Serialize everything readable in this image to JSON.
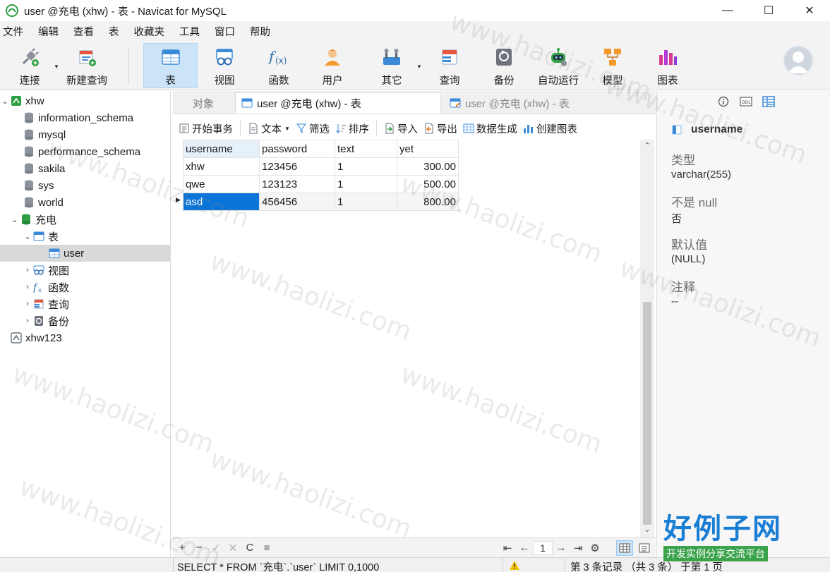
{
  "window": {
    "title": "user @充电 (xhw) - 表 - Navicat for MySQL",
    "controls": {
      "minimize": "—",
      "maximize": "☐",
      "close": "✕"
    }
  },
  "menu": [
    "文件",
    "编辑",
    "查看",
    "表",
    "收藏夹",
    "工具",
    "窗口",
    "帮助"
  ],
  "toolbar": {
    "items": [
      {
        "label": "连接",
        "icon": "connect-plug-icon",
        "has_dropdown": true
      },
      {
        "label": "新建查询",
        "icon": "new-query-icon"
      },
      {
        "label": "表",
        "icon": "table-icon",
        "active": true
      },
      {
        "label": "视图",
        "icon": "view-glasses-icon"
      },
      {
        "label": "函数",
        "icon": "function-fx-icon"
      },
      {
        "label": "用户",
        "icon": "user-person-icon"
      },
      {
        "label": "其它",
        "icon": "tools-icon",
        "has_dropdown": true
      },
      {
        "label": "查询",
        "icon": "query-icon"
      },
      {
        "label": "备份",
        "icon": "backup-icon"
      },
      {
        "label": "自动运行",
        "icon": "robot-icon"
      },
      {
        "label": "模型",
        "icon": "model-icon"
      },
      {
        "label": "图表",
        "icon": "chart-icon"
      }
    ]
  },
  "navigator": {
    "nodes": [
      {
        "label": "xhw",
        "level": 0,
        "expanded": true,
        "icon": "connection-icon"
      },
      {
        "label": "information_schema",
        "level": 1,
        "icon": "database-icon"
      },
      {
        "label": "mysql",
        "level": 1,
        "icon": "database-icon"
      },
      {
        "label": "performance_schema",
        "level": 1,
        "icon": "database-icon"
      },
      {
        "label": "sakila",
        "level": 1,
        "icon": "database-icon"
      },
      {
        "label": "sys",
        "level": 1,
        "icon": "database-icon"
      },
      {
        "label": "world",
        "level": 1,
        "icon": "database-icon"
      },
      {
        "label": "充电",
        "level": 1,
        "expanded": true,
        "icon": "database-open-icon"
      },
      {
        "label": "表",
        "level": 2,
        "expanded": true,
        "icon": "tables-folder-icon"
      },
      {
        "label": "user",
        "level": 3,
        "selected": true,
        "icon": "table-icon"
      },
      {
        "label": "视图",
        "level": 2,
        "collapsed": true,
        "icon": "views-folder-icon"
      },
      {
        "label": "函数",
        "level": 2,
        "collapsed": true,
        "icon": "functions-folder-icon"
      },
      {
        "label": "查询",
        "level": 2,
        "collapsed": true,
        "icon": "queries-folder-icon"
      },
      {
        "label": "备份",
        "level": 2,
        "collapsed": true,
        "icon": "backups-folder-icon"
      },
      {
        "label": "xhw123",
        "level": 0,
        "icon": "connection-closed-icon"
      }
    ]
  },
  "tabs": {
    "objects": "对象",
    "active": "user @充电 (xhw) - 表",
    "inactive": "user @充电 (xhw) - 表"
  },
  "grid_toolbar": {
    "begin_transaction": "开始事务",
    "text": "文本",
    "filter": "筛选",
    "sort": "排序",
    "import": "导入",
    "export": "导出",
    "generate_data": "数据生成",
    "create_chart": "创建图表"
  },
  "grid": {
    "columns": [
      "username",
      "password",
      "text",
      "yet"
    ],
    "rows": [
      [
        "xhw",
        "123456",
        "1",
        "300.00"
      ],
      [
        "qwe",
        "123123",
        "1",
        "500.00"
      ],
      [
        "asd",
        "456456",
        "1",
        "800.00"
      ]
    ],
    "current_row": 2
  },
  "grid_footer": {
    "add": "+",
    "delete": "−",
    "apply": "✓",
    "discard": "✕",
    "refresh": "C",
    "stop": "■",
    "first": "⇤",
    "prev": "←",
    "page": "1",
    "next": "→",
    "last": "⇥",
    "settings": "⚙"
  },
  "info_panel": {
    "field_name": "username",
    "type_label": "类型",
    "type_value": "varchar(255)",
    "not_null_label": "不是 null",
    "not_null_value": "否",
    "default_label": "默认值",
    "default_value": "(NULL)",
    "comment_label": "注释",
    "comment_value": "--"
  },
  "statusbar": {
    "sql": "SELECT * FROM `充电`.`user` LIMIT 0,1000",
    "record_count": "第 3 条记录 （共 3 条） 于第 1 页"
  },
  "watermark": {
    "text": "www.haolizi.com",
    "brand_big": "好例子网",
    "brand_small": "开发实例分享交流平台"
  },
  "colors": {
    "accent": "#0a74d9",
    "toolbar_active": "#cce4f7",
    "database_open": "#28a745"
  }
}
